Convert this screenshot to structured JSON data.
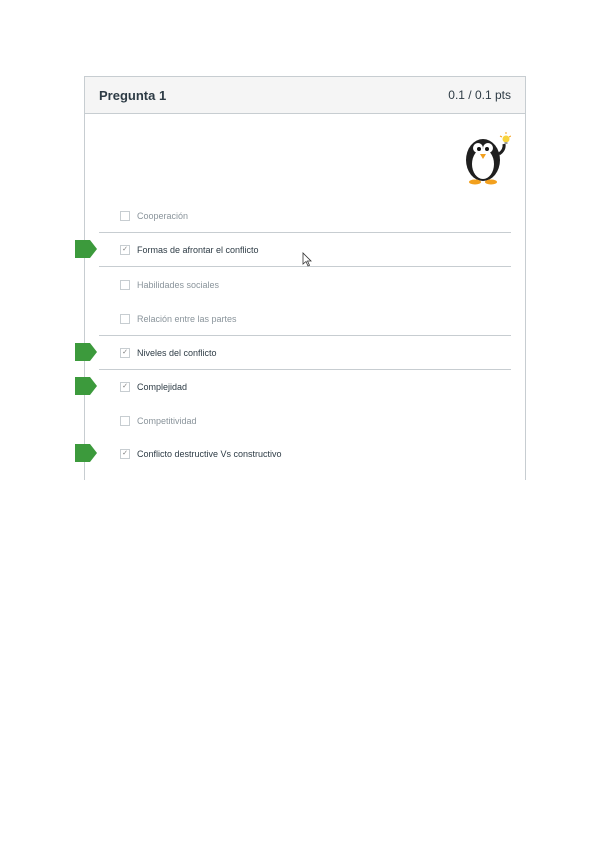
{
  "question": {
    "title": "Pregunta 1",
    "points": "0.1 / 0.1 pts"
  },
  "answers": [
    {
      "label": "Cooperación",
      "selected": false
    },
    {
      "label": "Formas de afrontar el conflicto",
      "selected": true
    },
    {
      "label": "Habilidades sociales",
      "selected": false
    },
    {
      "label": "Relación entre las partes",
      "selected": false
    },
    {
      "label": "Niveles del conflicto",
      "selected": true
    },
    {
      "label": "Complejidad",
      "selected": true
    },
    {
      "label": "Competitividad",
      "selected": false
    },
    {
      "label": "Conflicto destructive Vs constructivo",
      "selected": true
    }
  ],
  "colors": {
    "correct_flag": "#3c9a3c",
    "border": "#c7cdd1",
    "header_bg": "#f5f5f5"
  },
  "icons": {
    "mascot": "penguin-with-lightbulb-icon",
    "correct": "correct-answer-flag-icon",
    "cursor": "mouse-pointer-icon"
  }
}
